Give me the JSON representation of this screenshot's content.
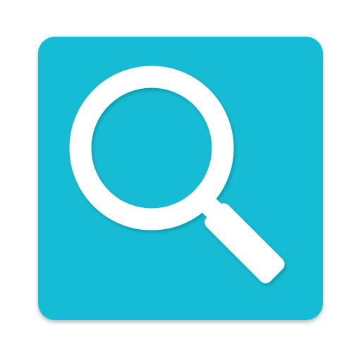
{
  "app_icon": {
    "icon": "magnifying-glass-icon",
    "colors": {
      "tile": "#12BCD3",
      "tile_top": "#1AC3D8",
      "glyph": "#FFFFFF",
      "shadow": "#00838F"
    }
  }
}
